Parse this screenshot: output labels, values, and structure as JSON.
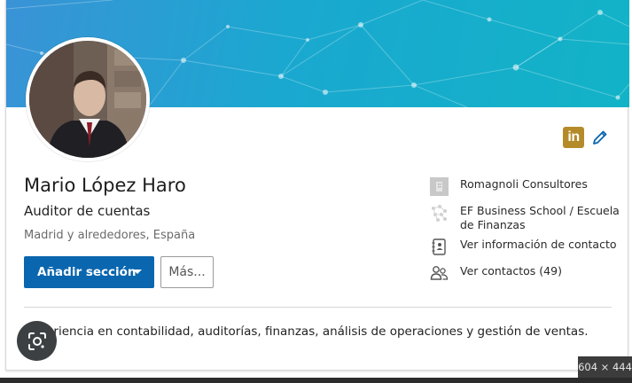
{
  "profile": {
    "name": "Mario López Haro",
    "headline": "Auditor de cuentas",
    "location": "Madrid y alrededores, España",
    "summary": "Experiencia en contabilidad, auditorías, finanzas, análisis de operaciones y gestión de ventas."
  },
  "actions": {
    "add_section_label": "Añadir sección",
    "more_label": "Más..."
  },
  "linkedin_badge": {
    "text": "in"
  },
  "sidebar": {
    "items": [
      {
        "label": "Romagnoli Consultores",
        "icon": "company-icon"
      },
      {
        "label": "EF Business School / Escuela de Finanzas",
        "icon": "school-icon"
      },
      {
        "label": "Ver información de contacto",
        "icon": "contact-card-icon"
      },
      {
        "label": "Ver contactos (49)",
        "icon": "people-icon"
      }
    ]
  },
  "overlay": {
    "image_dimensions": "604 × 444",
    "lens_icon": "lens-search-icon"
  },
  "colors": {
    "banner": "#1aa8d0",
    "primary_button": "#0a66ae",
    "linkedin_badge": "#b58b2a",
    "edit_pencil": "#0a66ae"
  }
}
